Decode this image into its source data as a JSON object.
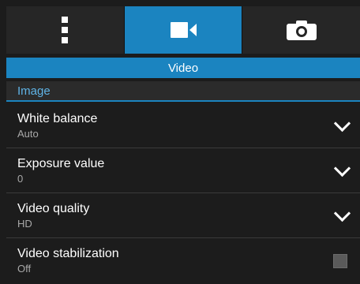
{
  "tabs": [
    {
      "name": "more-options",
      "icon": "dots-icon"
    },
    {
      "name": "video",
      "icon": "video-camera-icon",
      "active": true
    },
    {
      "name": "camera",
      "icon": "camera-icon"
    }
  ],
  "title": "Video",
  "section": "Image",
  "settings": [
    {
      "label": "White balance",
      "value": "Auto",
      "control": "chevron-down-icon"
    },
    {
      "label": "Exposure value",
      "value": "0",
      "control": "chevron-down-icon"
    },
    {
      "label": "Video quality",
      "value": "HD",
      "control": "chevron-down-icon"
    },
    {
      "label": "Video stabilization",
      "value": "Off",
      "control": "checkbox",
      "checked": false
    }
  ],
  "colors": {
    "accent": "#1b84c0",
    "section_text": "#5fb3e6",
    "background": "#1c1c1c"
  }
}
